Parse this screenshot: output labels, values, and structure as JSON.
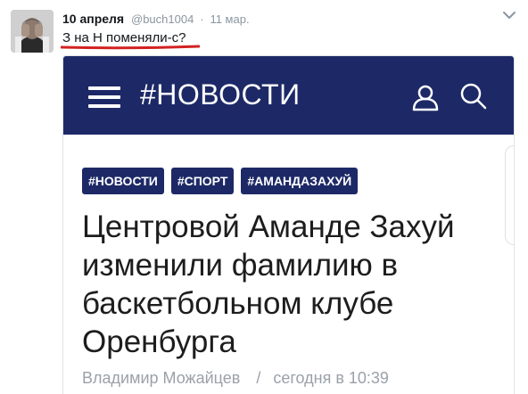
{
  "tweet": {
    "author_name": "10 апреля",
    "author_handle": "@buch1004",
    "separator": "·",
    "date": "11 мар.",
    "text": "З на Н поменяли-с?"
  },
  "card": {
    "site_title": "#НОВОСТИ",
    "tags": [
      {
        "label": "#НОВОСТИ"
      },
      {
        "label": "#СПОРТ"
      },
      {
        "label": "#АМАНДАЗАХУЙ"
      }
    ],
    "headline": "Центровой Аманде Захуй изменили фамилию в баскетбольном клубе Оренбурга",
    "byline": {
      "author": "Владимир Можайцев",
      "separator": "/",
      "time": "сегодня в 10:39"
    }
  },
  "icons": {
    "menu": "hamburger-menu-icon",
    "user": "user-icon",
    "search": "search-icon",
    "chevron": "chevron-down-icon"
  },
  "colors": {
    "header_bg": "#1d2967",
    "tag_bg": "#1d2967",
    "underline_mark": "#d32222",
    "muted_text": "#8a959f"
  }
}
